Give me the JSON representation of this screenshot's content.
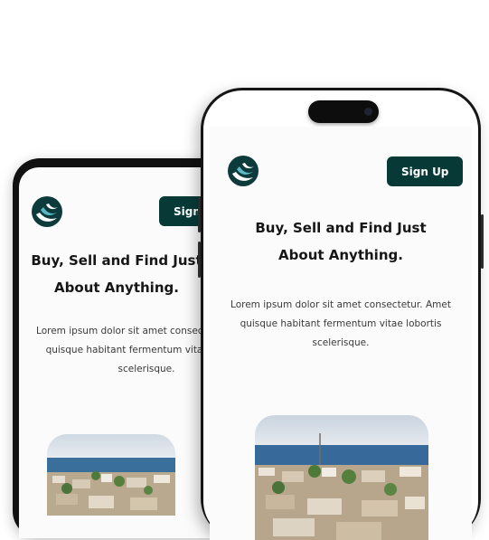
{
  "hero": {
    "headline_line1": "Buy, Sell and Find Just",
    "headline_line2": "About Anything.",
    "body_line1": "Lorem ipsum dolor sit amet consectetur. Amet",
    "body_line2": "quisque habitant fermentum vitae lobortis",
    "body_line3": "scelerisque."
  },
  "header": {
    "signup_label": "Sign Up",
    "logo_icon": "bird-logo-icon"
  },
  "hero_image": {
    "description_icon": "coastal-city-photo"
  },
  "colors": {
    "brand": "#073a37",
    "logo": "#0d3a3b",
    "background": "#fbfbfb"
  }
}
